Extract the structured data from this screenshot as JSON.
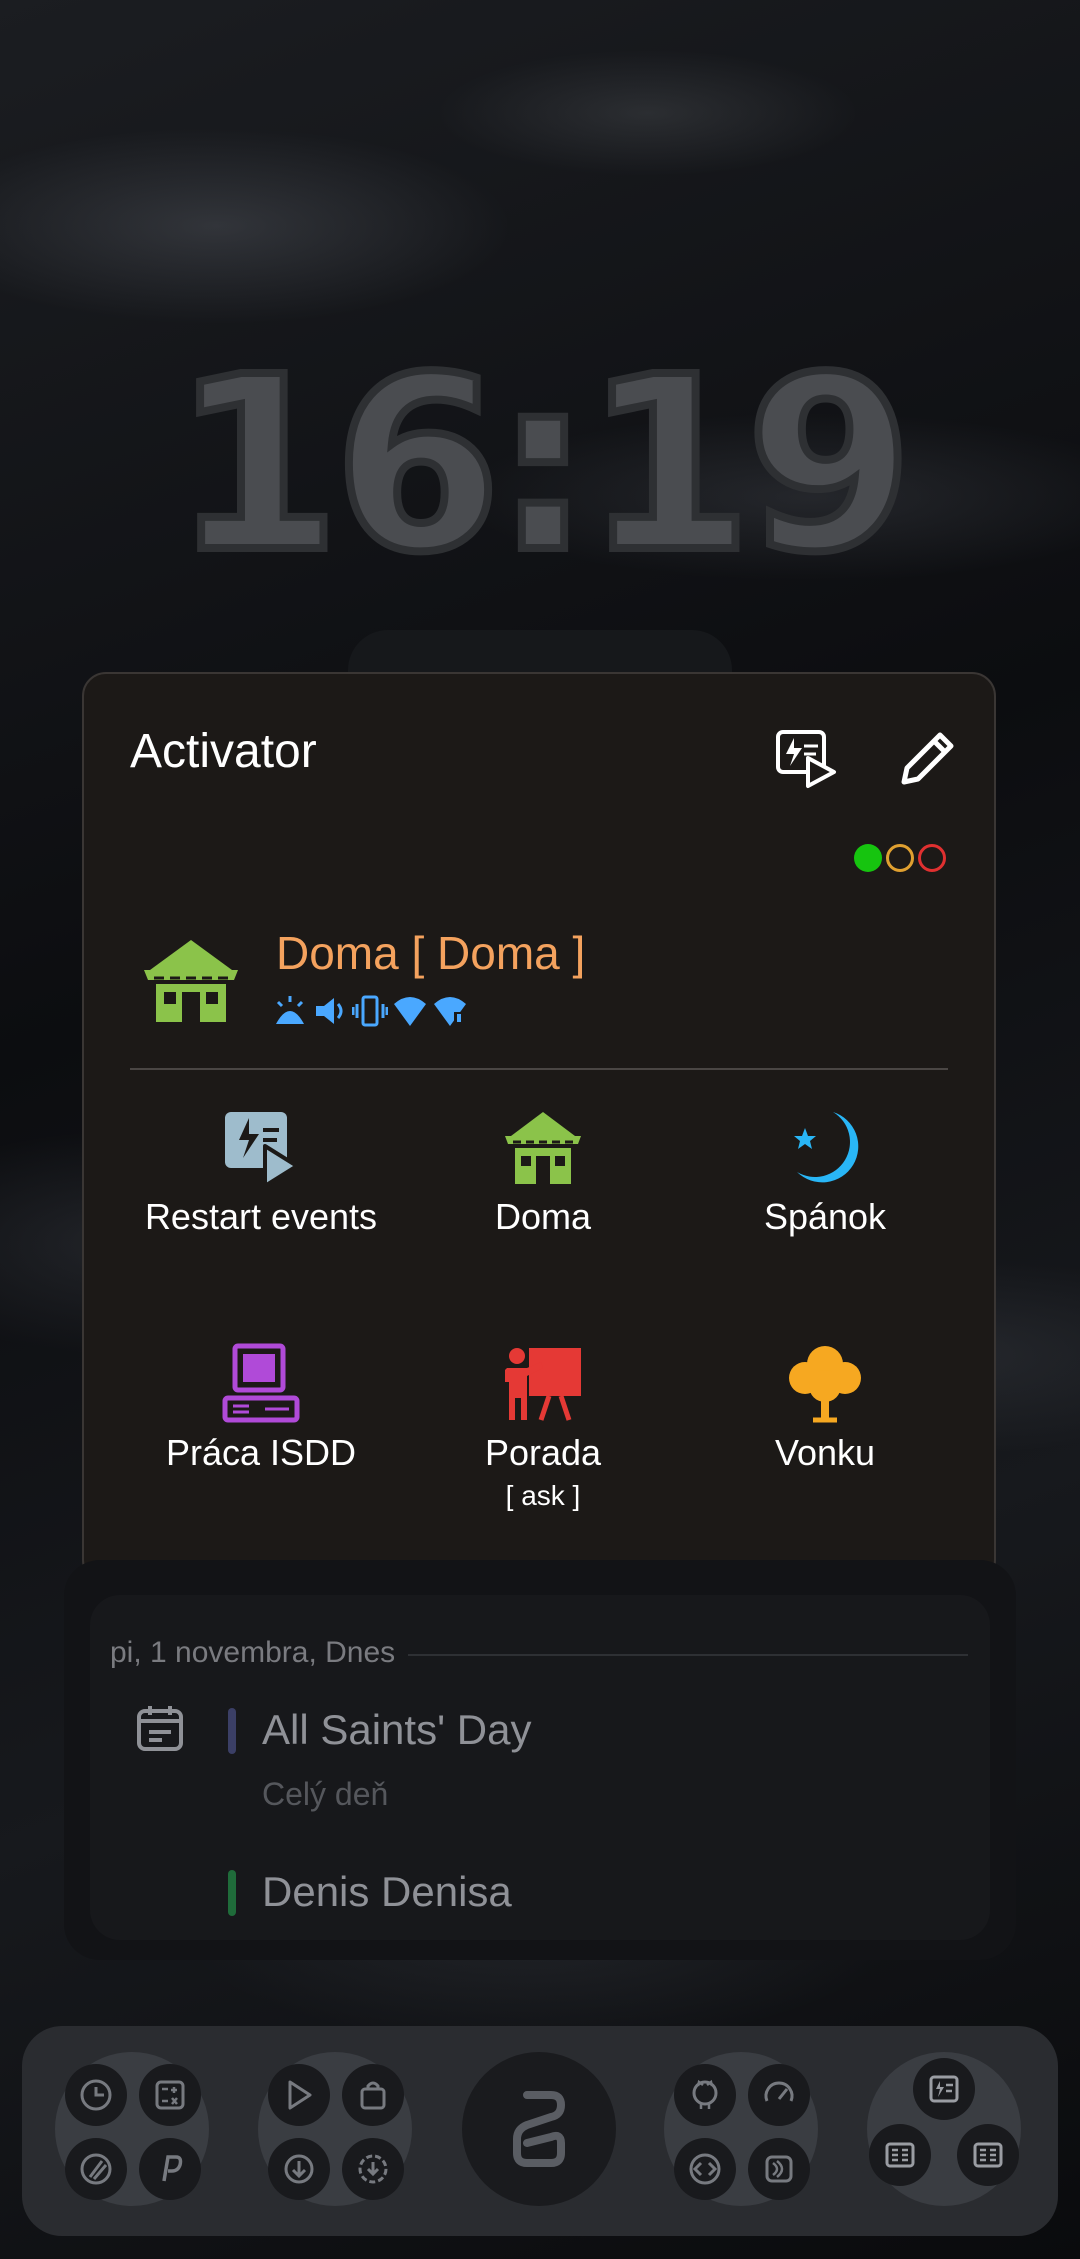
{
  "clock": {
    "time": "16:19"
  },
  "activator": {
    "title": "Activator",
    "profile": {
      "name": "Doma [ Doma ]"
    },
    "status_dots": [
      "#16c40f",
      "#e0a030",
      "#e03030"
    ],
    "tiles": [
      {
        "label": "Restart events",
        "icon": "restart-events-icon"
      },
      {
        "label": "Doma",
        "icon": "house-icon"
      },
      {
        "label": "Spánok",
        "icon": "moon-star-icon"
      },
      {
        "label": "Práca ISDD",
        "icon": "computer-icon"
      },
      {
        "label": "Porada",
        "sub": "[ ask ]",
        "icon": "presentation-icon"
      },
      {
        "label": "Vonku",
        "icon": "tree-icon"
      }
    ]
  },
  "calendar": {
    "date_header": "pi, 1 novembra, Dnes",
    "events": [
      {
        "title": "All Saints' Day",
        "sub": "Celý deň",
        "color": "#3b3f66"
      },
      {
        "title": "Denis Denisa",
        "color": "#1f6b3a"
      }
    ]
  }
}
